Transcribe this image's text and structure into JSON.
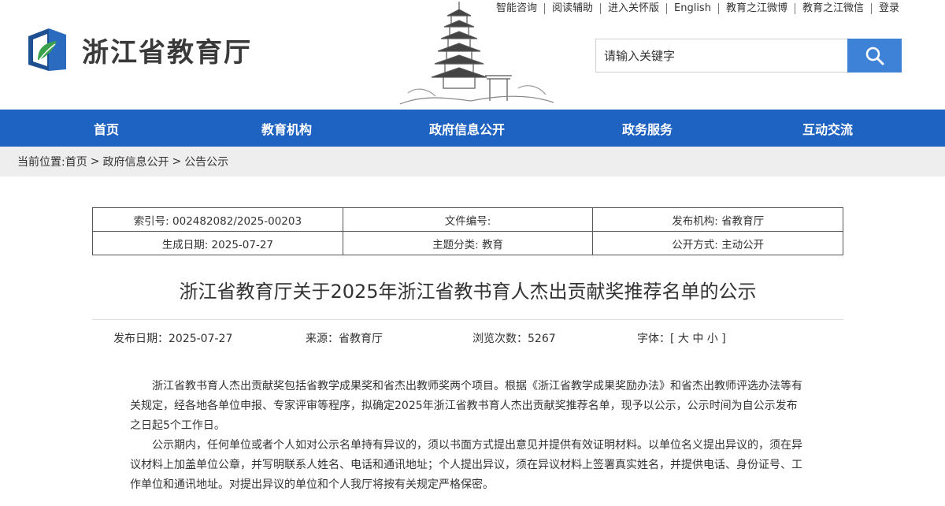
{
  "site": {
    "name": "浙江省教育厅"
  },
  "toplinks": [
    "智能咨询",
    "阅读辅助",
    "进入关怀版",
    "English",
    "教育之江微博",
    "教育之江微信",
    "登录"
  ],
  "search": {
    "placeholder": "请输入关键字"
  },
  "nav": [
    "首页",
    "教育机构",
    "政府信息公开",
    "政务服务",
    "互动交流"
  ],
  "breadcrumb": {
    "prefix": "当前位置:",
    "items": [
      "首页",
      "政府信息公开",
      "公告公示"
    ],
    "sep": ">"
  },
  "meta": {
    "index_no": "索引号: 002482082/2025-00203",
    "doc_no": "文件编号:",
    "publisher": "发布机构: 省教育厅",
    "created": "生成日期: 2025-07-27",
    "topic": "主题分类: 教育",
    "disclosure": "公开方式: 主动公开"
  },
  "article": {
    "title": "浙江省教育厅关于2025年浙江省教书育人杰出贡献奖推荐名单的公示",
    "date": "发布日期：2025-07-27",
    "source": "来源：省教育厅",
    "views": "浏览次数：5267",
    "font": "字体：[ 大 中 小 ]",
    "paragraphs": [
      "浙江省教书育人杰出贡献奖包括省教学成果奖和省杰出教师奖两个项目。根据《浙江省教学成果奖励办法》和省杰出教师评选办法等有关规定，经各地各单位申报、专家评审等程序，拟确定2025年浙江省教书育人杰出贡献奖推荐名单，现予以公示，公示时间为自公示发布之日起5个工作日。",
      "公示期内，任何单位或者个人如对公示名单持有异议的，须以书面方式提出意见并提供有效证明材料。以单位名义提出异议的，须在异议材料上加盖单位公章，并写明联系人姓名、电话和通讯地址；个人提出异议，须在异议材料上签署真实姓名，并提供电话、身份证号、工作单位和通讯地址。对提出异议的单位和个人我厅将按有关规定严格保密。"
    ]
  }
}
